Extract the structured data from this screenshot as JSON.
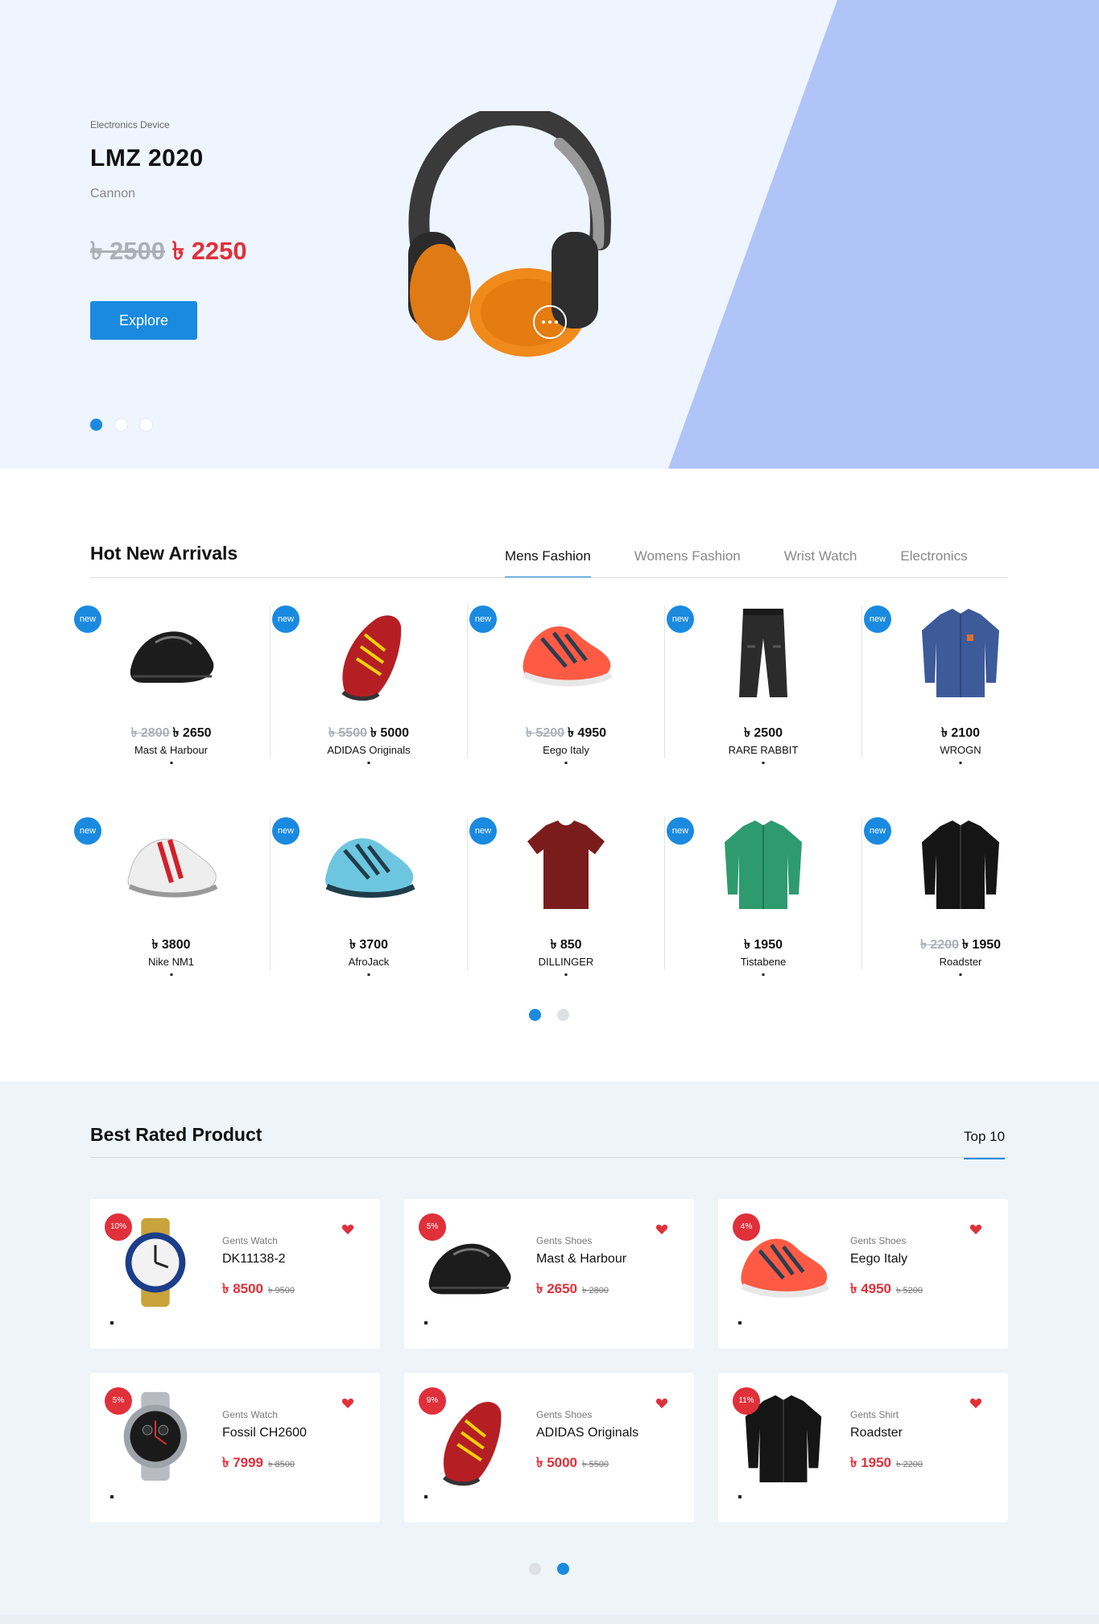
{
  "hero": {
    "category": "Electronics Device",
    "title": "LMZ 2020",
    "brand": "Cannon",
    "old_price": "৳ 2500",
    "new_price": "৳ 2250",
    "button_label": "Explore",
    "slides": 3,
    "active_slide": 1,
    "image": "headphones"
  },
  "arrivals": {
    "title": "Hot New Arrivals",
    "tabs": [
      {
        "label": "Mens Fashion",
        "active": true
      },
      {
        "label": "Womens Fashion",
        "active": false
      },
      {
        "label": "Wrist Watch",
        "active": false
      },
      {
        "label": "Electronics",
        "active": false
      }
    ],
    "badge_label": "new",
    "products": [
      {
        "name": "Mast & Harbour",
        "old_price": "৳ 2800",
        "price": "৳ 2650",
        "image": "loafer-black"
      },
      {
        "name": "ADIDAS Originals",
        "old_price": "৳ 5500",
        "price": "৳ 5000",
        "image": "sneaker-red-yellow"
      },
      {
        "name": "Eego Italy",
        "old_price": "৳ 5200",
        "price": "৳ 4950",
        "image": "sneaker-coral"
      },
      {
        "name": "RARE RABBIT",
        "old_price": "",
        "price": "৳ 2500",
        "image": "pants-black"
      },
      {
        "name": "WROGN",
        "old_price": "",
        "price": "৳ 2100",
        "image": "shirt-blue"
      },
      {
        "name": "Nike NM1",
        "old_price": "",
        "price": "৳ 3800",
        "image": "sneaker-white-red"
      },
      {
        "name": "AfroJack",
        "old_price": "",
        "price": "৳ 3700",
        "image": "sneaker-blue"
      },
      {
        "name": "DILLINGER",
        "old_price": "",
        "price": "৳ 850",
        "image": "tshirt-maroon"
      },
      {
        "name": "Tistabene",
        "old_price": "",
        "price": "৳ 1950",
        "image": "shirt-green"
      },
      {
        "name": "Roadster",
        "old_price": "৳ 2200",
        "price": "৳ 1950",
        "image": "shirt-black"
      }
    ],
    "pages": 2,
    "active_page": 1
  },
  "best_rated": {
    "title": "Best Rated Product",
    "tab_label": "Top 10",
    "products": [
      {
        "discount": "10%",
        "category": "Gents Watch",
        "name": "DK11138-2",
        "price": "৳ 8500",
        "old_price": "৳ 9500",
        "image": "watch-gold"
      },
      {
        "discount": "5%",
        "category": "Gents Shoes",
        "name": "Mast & Harbour",
        "price": "৳ 2650",
        "old_price": "৳ 2800",
        "image": "loafer-black"
      },
      {
        "discount": "4%",
        "category": "Gents Shoes",
        "name": "Eego Italy",
        "price": "৳ 4950",
        "old_price": "৳ 5200",
        "image": "sneaker-coral"
      },
      {
        "discount": "5%",
        "category": "Gents Watch",
        "name": "Fossil CH2600",
        "price": "৳ 7999",
        "old_price": "৳ 8500",
        "image": "watch-steel"
      },
      {
        "discount": "9%",
        "category": "Gents Shoes",
        "name": "ADIDAS Originals",
        "price": "৳ 5000",
        "old_price": "৳ 5500",
        "image": "sneaker-red-yellow"
      },
      {
        "discount": "11%",
        "category": "Gents Shirt",
        "name": "Roadster",
        "price": "৳ 1950",
        "old_price": "৳ 2200",
        "image": "shirt-black"
      }
    ],
    "pages": 2,
    "active_page": 2
  },
  "colors": {
    "accent": "#1a8ae0",
    "sale_red": "#e0303a",
    "hero_bg": "#eff5ff",
    "hero_shape": "#b0c4f8"
  }
}
